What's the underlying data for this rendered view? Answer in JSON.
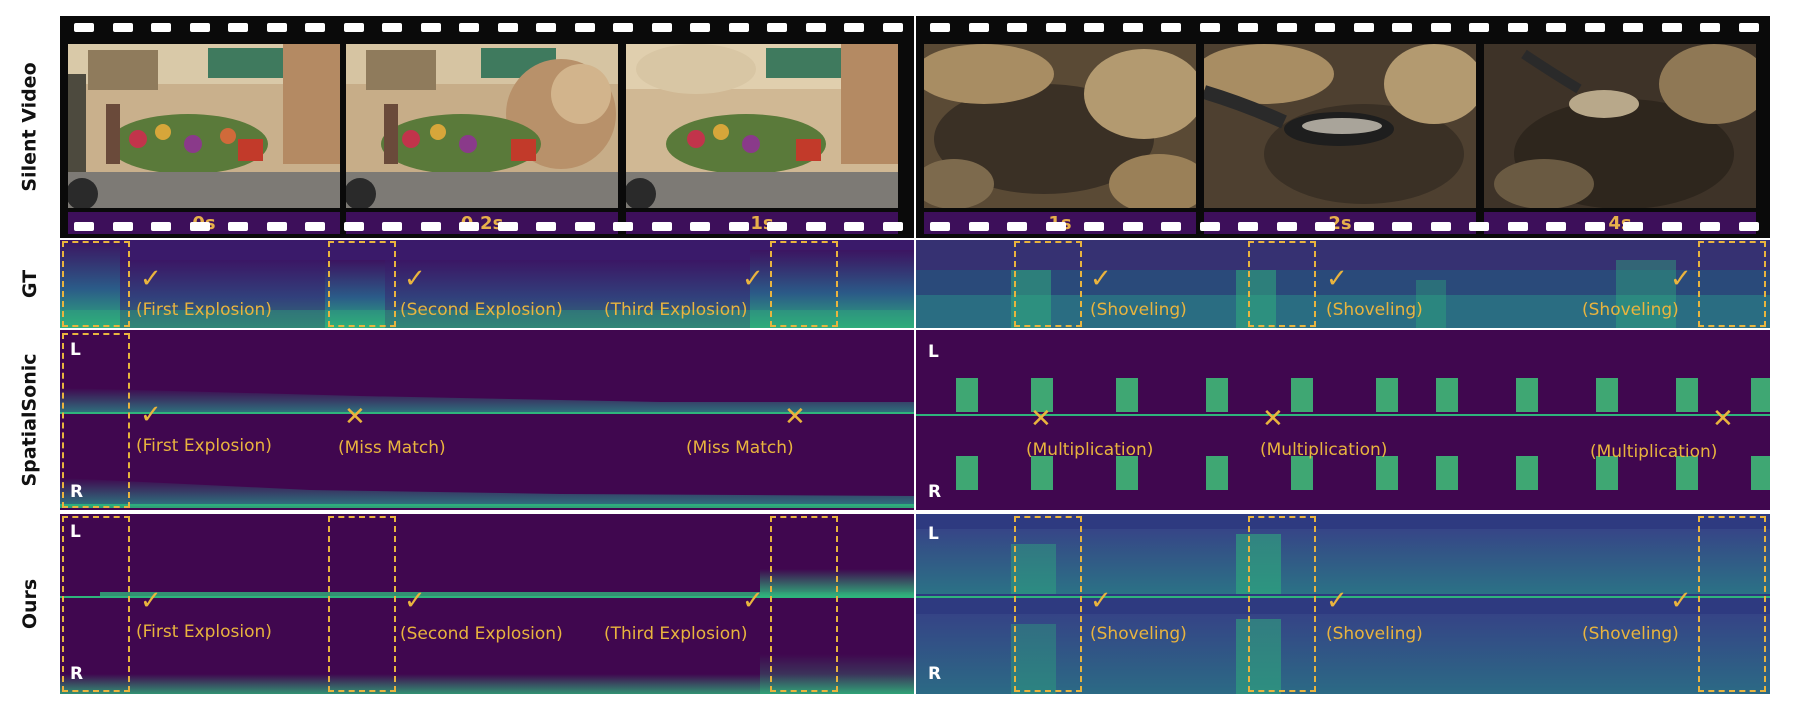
{
  "row_labels": {
    "silent_video": "Silent Video",
    "gt": "GT",
    "spatialsonic": "SpatialSonic",
    "ours": "Ours"
  },
  "left_timestamps": [
    "0s",
    "0.2s",
    "1s"
  ],
  "right_timestamps": [
    "1s",
    "2s",
    "4s"
  ],
  "gt": {
    "left": [
      "(First Explosion)",
      "(Second Explosion)",
      "(Third Explosion)"
    ],
    "right": [
      "(Shoveling)",
      "(Shoveling)",
      "(Shoveling)"
    ]
  },
  "spatialsonic": {
    "left": [
      "(First Explosion)",
      "(Miss Match)",
      "(Miss Match)"
    ],
    "right": [
      "(Multiplication)",
      "(Multiplication)",
      "(Multiplication)"
    ]
  },
  "ours": {
    "left": [
      "(First Explosion)",
      "(Second Explosion)",
      "(Third Explosion)"
    ],
    "right": [
      "(Shoveling)",
      "(Shoveling)",
      "(Shoveling)"
    ]
  },
  "channels": {
    "left": "L",
    "right": "R"
  },
  "marks": {
    "check": "✓",
    "cross": "✕"
  },
  "colors": {
    "annotation": "#e9b43e",
    "spectrogram_bg": "#40074f",
    "timestamp_bar": "#3d0f5a",
    "spectrogram_bright": "#2fb47c"
  }
}
